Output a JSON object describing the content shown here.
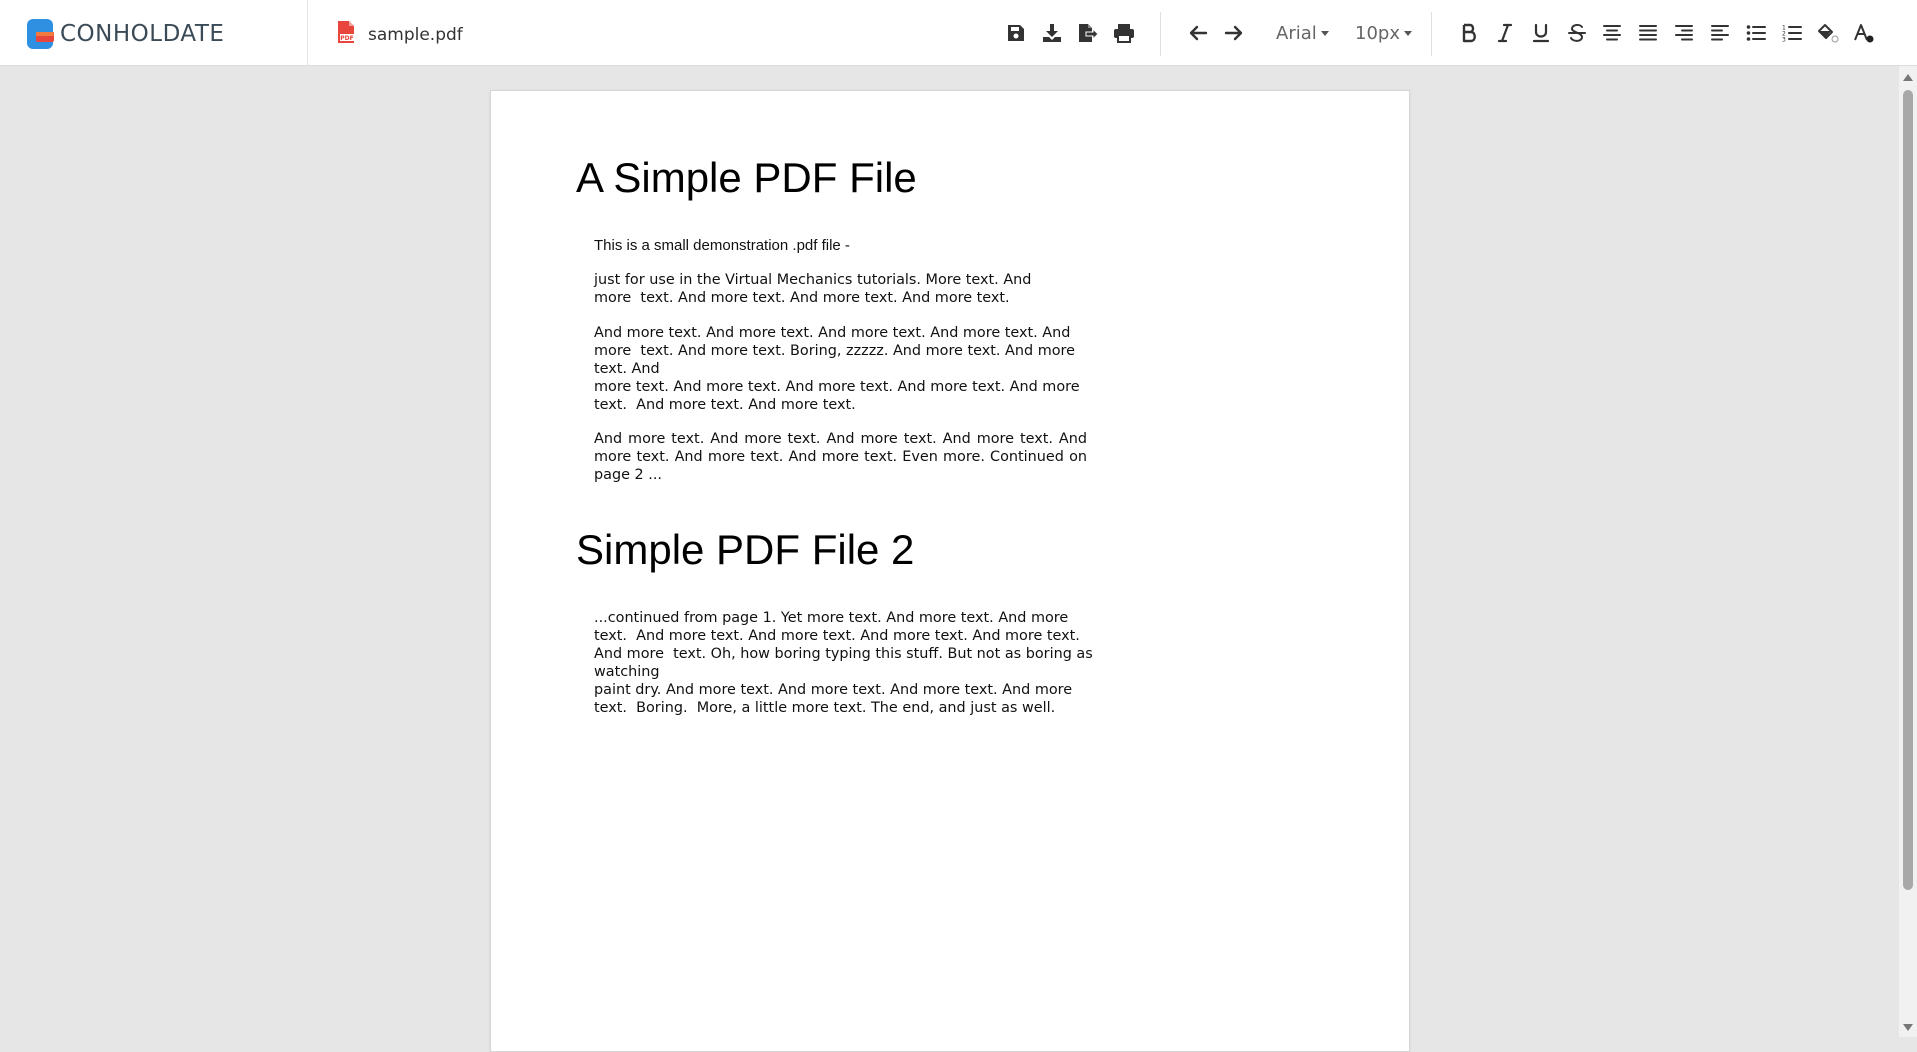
{
  "header": {
    "logo_text": "CONHOLDATE",
    "file_name": "sample.pdf",
    "brand_blue": "#2f8fe0",
    "brand_red": "#e8453c",
    "pdf_badge": "PDF"
  },
  "toolbar": {
    "font_family": "Arial",
    "font_size": "10px",
    "buttons": [
      "save-icon",
      "download-icon",
      "export-icon",
      "print-icon",
      "undo-icon",
      "redo-icon",
      "bold-icon",
      "italic-icon",
      "underline-icon",
      "strikethrough-icon",
      "align-center-icon",
      "align-justify-icon",
      "align-right-icon",
      "align-left-icon",
      "bulleted-list-icon",
      "numbered-list-icon",
      "fill-color-icon",
      "text-color-icon"
    ]
  },
  "document": {
    "heading1": "A Simple PDF File",
    "para1": "This is a small demonstration .pdf file -",
    "para2_lines": [
      "just for use in the Virtual Mechanics tutorials. More text. And",
      "more  text. And more text. And more text. And more text."
    ],
    "para3_lines": [
      "And more text. And more text. And more text. And more text. And",
      "more  text. And more text. Boring, zzzzz. And more text. And more",
      "text. And",
      "more text. And more text. And more text. And more text. And more",
      "text.  And more text. And more text."
    ],
    "para4_lines": [
      "And more text. And more text. And more text. And more text. And",
      "more  text. And more text. And more text. Even more. Continued on",
      "page 2 ..."
    ],
    "heading2": "Simple PDF File 2",
    "para5_lines": [
      "...continued from page 1. Yet more text. And more text. And more",
      "text.  And more text. And more text. And more text. And more text.",
      "And more  text. Oh, how boring typing this stuff. But not as boring as",
      "watching",
      "paint dry. And more text. And more text. And more text. And more",
      "text.  Boring.  More, a little more text. The end, and just as well."
    ]
  }
}
